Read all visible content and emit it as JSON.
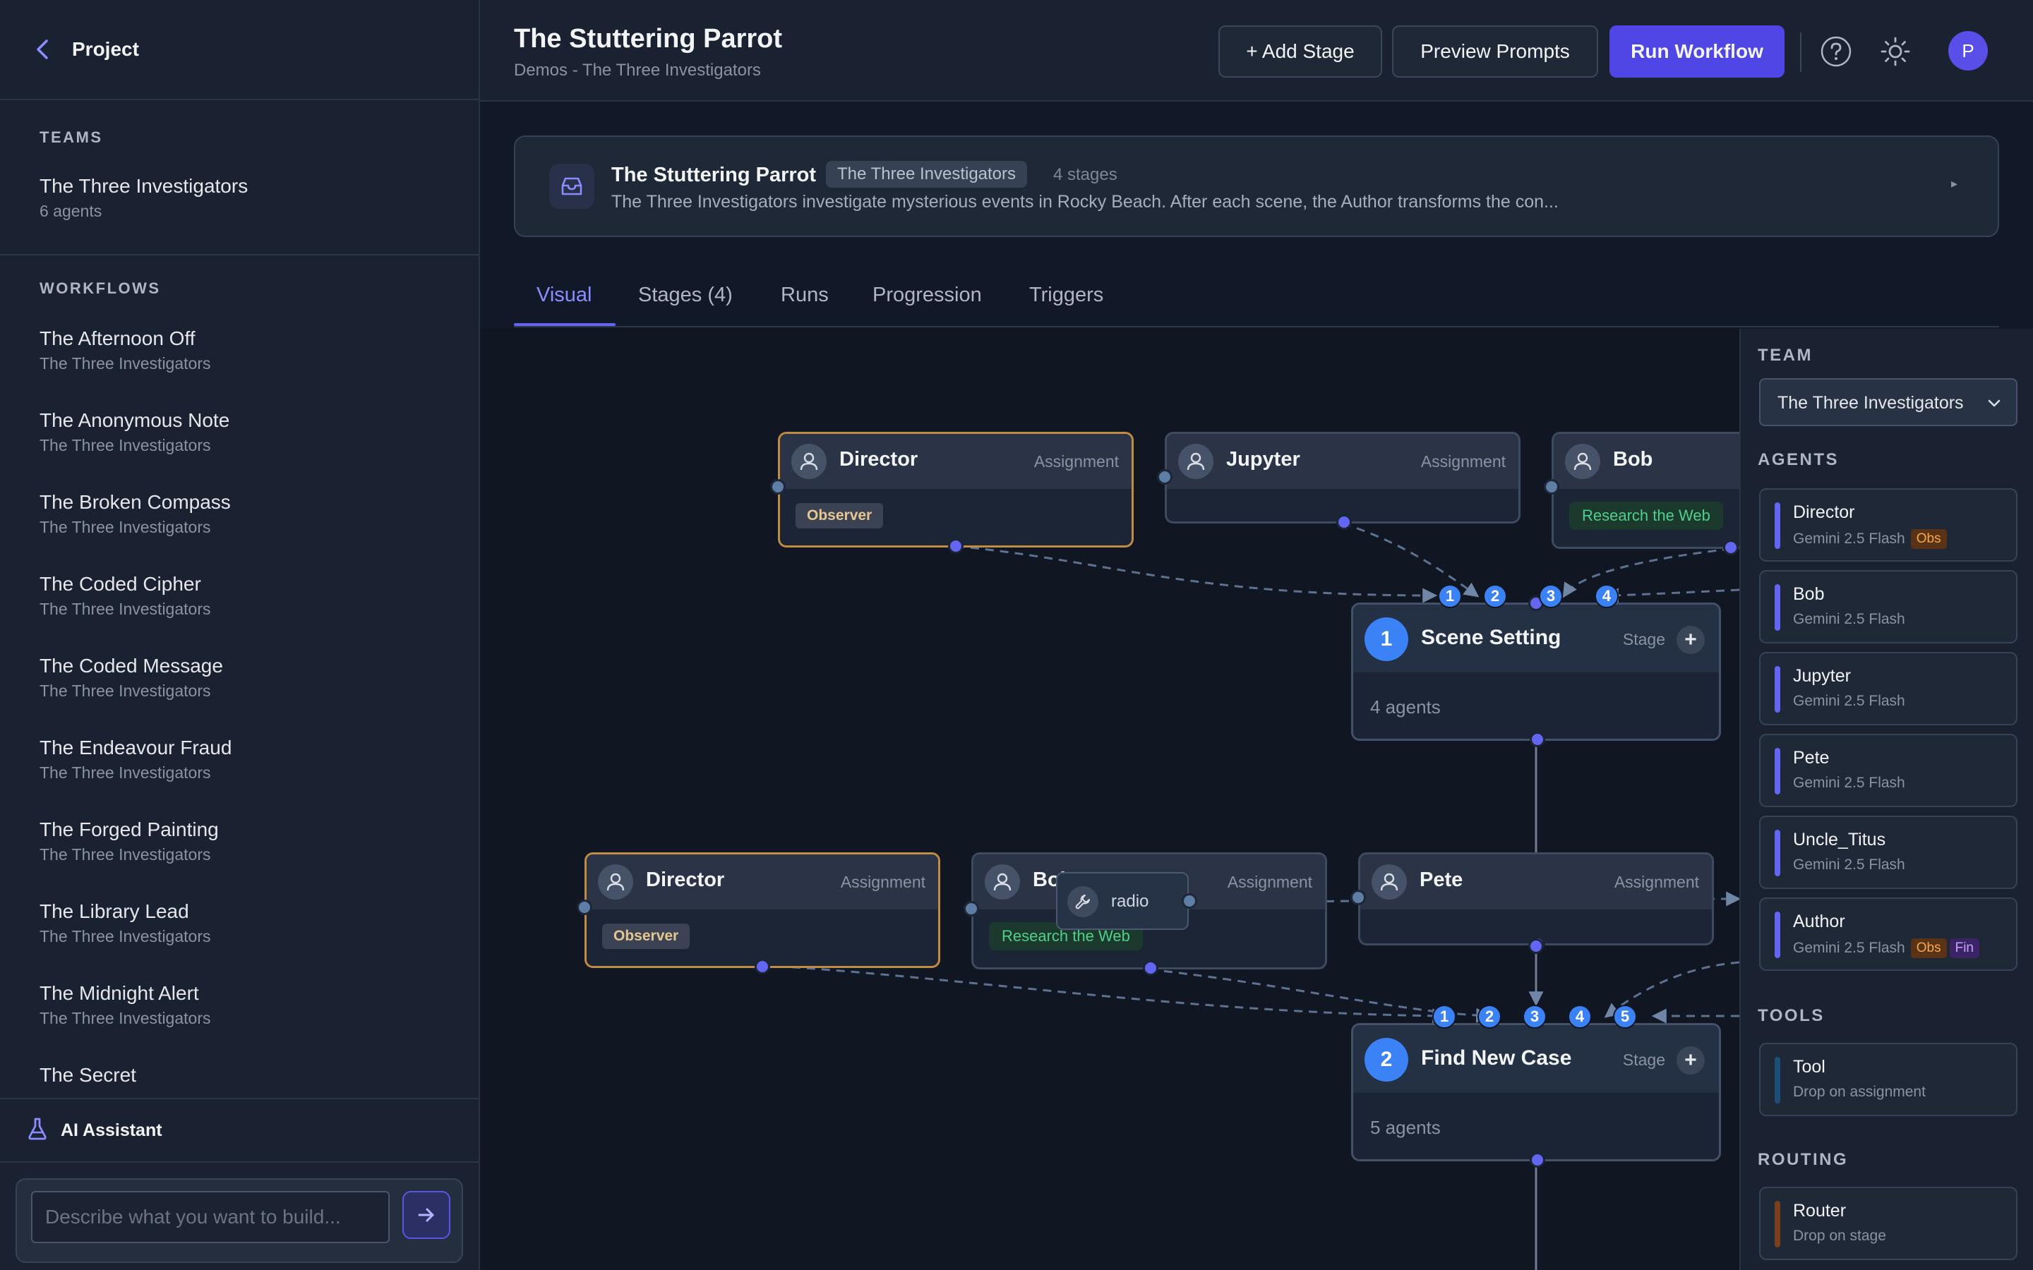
{
  "sidebar": {
    "project_label": "Project",
    "teams_title": "TEAMS",
    "team": {
      "name": "The Three Investigators",
      "sub": "6 agents"
    },
    "workflows_title": "WORKFLOWS",
    "workflows": [
      {
        "name": "The Afternoon Off",
        "sub": "The Three Investigators"
      },
      {
        "name": "The Anonymous Note",
        "sub": "The Three Investigators"
      },
      {
        "name": "The Broken Compass",
        "sub": "The Three Investigators"
      },
      {
        "name": "The Coded Cipher",
        "sub": "The Three Investigators"
      },
      {
        "name": "The Coded Message",
        "sub": "The Three Investigators"
      },
      {
        "name": "The Endeavour Fraud",
        "sub": "The Three Investigators"
      },
      {
        "name": "The Forged Painting",
        "sub": "The Three Investigators"
      },
      {
        "name": "The Library Lead",
        "sub": "The Three Investigators"
      },
      {
        "name": "The Midnight Alert",
        "sub": "The Three Investigators"
      },
      {
        "name": "The Secret",
        "sub": ""
      }
    ],
    "ai_label": "AI Assistant",
    "ai_placeholder": "Describe what you want to build..."
  },
  "header": {
    "title": "The Stuttering Parrot",
    "breadcrumb": "Demos - The Three Investigators",
    "add_stage": "+ Add Stage",
    "preview_prompts": "Preview Prompts",
    "run_workflow": "Run Workflow",
    "avatar_initial": "P"
  },
  "info": {
    "title": "The Stuttering Parrot",
    "team_badge": "The Three Investigators",
    "stage_count": "4 stages",
    "description": "The Three Investigators investigate mysterious events in Rocky Beach. After each scene, the Author transforms the con...",
    "toggle": "▸"
  },
  "tabs": [
    "Visual",
    "Stages (4)",
    "Runs",
    "Progression",
    "Triggers"
  ],
  "canvas": {
    "assignment_label": "Assignment",
    "stage_label": "Stage",
    "observer_label": "Observer",
    "research_label": "Research the Web",
    "tool_name": "radio",
    "nodes_row1": [
      {
        "name": "Director",
        "tag": "Observer"
      },
      {
        "name": "Jupyter"
      },
      {
        "name": "Bob",
        "tag": "Research the Web"
      }
    ],
    "nodes_row2": [
      {
        "name": "Director",
        "tag": "Observer"
      },
      {
        "name": "Bob",
        "tag": "Research the Web"
      },
      {
        "name": "Pete"
      }
    ],
    "stages": [
      {
        "num": "1",
        "name": "Scene Setting",
        "agents": "4 agents",
        "inputs": [
          "1",
          "2",
          "3",
          "4"
        ]
      },
      {
        "num": "2",
        "name": "Find New Case",
        "agents": "5 agents",
        "inputs": [
          "1",
          "2",
          "3",
          "4",
          "5"
        ]
      }
    ]
  },
  "palette": {
    "team_title": "TEAM",
    "team_selected": "The Three Investigators",
    "agents_title": "AGENTS",
    "agents": [
      {
        "name": "Director",
        "model": "Gemini 2.5 Flash",
        "tags": [
          "Obs"
        ]
      },
      {
        "name": "Bob",
        "model": "Gemini 2.5 Flash",
        "tags": []
      },
      {
        "name": "Jupyter",
        "model": "Gemini 2.5 Flash",
        "tags": []
      },
      {
        "name": "Pete",
        "model": "Gemini 2.5 Flash",
        "tags": []
      },
      {
        "name": "Uncle_Titus",
        "model": "Gemini 2.5 Flash",
        "tags": []
      },
      {
        "name": "Author",
        "model": "Gemini 2.5 Flash",
        "tags": [
          "Obs",
          "Fin"
        ]
      }
    ],
    "tools_title": "TOOLS",
    "tool": {
      "name": "Tool",
      "sub": "Drop on assignment"
    },
    "routing_title": "ROUTING",
    "router": {
      "name": "Router",
      "sub": "Drop on stage"
    }
  },
  "colors": {
    "accent": "#4f46e5",
    "stage_blue": "#3b82f6",
    "observer_border": "#c08b42",
    "research_green": "#4fcf8b",
    "tool_bar": "#1e4f79",
    "router_bar": "#7a3f1c"
  }
}
